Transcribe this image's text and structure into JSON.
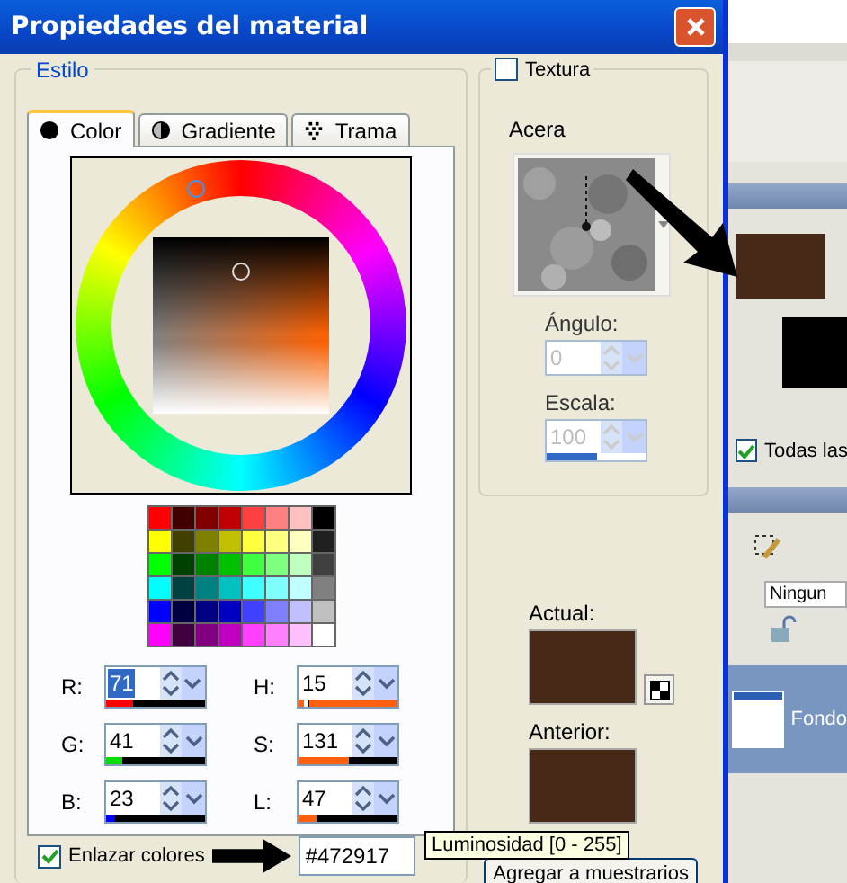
{
  "window": {
    "title": "Propiedades del material"
  },
  "style_group": {
    "title": "Estilo"
  },
  "tabs": [
    {
      "label": "Color",
      "selected": true,
      "kind": "solid"
    },
    {
      "label": "Gradiente",
      "selected": false,
      "kind": "gradient"
    },
    {
      "label": "Trama",
      "selected": false,
      "kind": "pattern"
    }
  ],
  "palette": [
    {
      "color": "#ff0000"
    },
    {
      "color": "#400000"
    },
    {
      "color": "#800000"
    },
    {
      "color": "#c00000"
    },
    {
      "color": "#ff4040"
    },
    {
      "color": "#ff8080"
    },
    {
      "color": "#ffc0c0"
    },
    {
      "color": "#000000"
    },
    {
      "color": "#ffff00"
    },
    {
      "color": "#404000"
    },
    {
      "color": "#808000"
    },
    {
      "color": "#c0c000"
    },
    {
      "color": "#ffff40"
    },
    {
      "color": "#ffff80"
    },
    {
      "color": "#ffffc0"
    },
    {
      "color": "#202020"
    },
    {
      "color": "#00ff00"
    },
    {
      "color": "#004000"
    },
    {
      "color": "#008000"
    },
    {
      "color": "#00c000"
    },
    {
      "color": "#40ff40"
    },
    {
      "color": "#80ff80"
    },
    {
      "color": "#c0ffc0"
    },
    {
      "color": "#404040"
    },
    {
      "color": "#00ffff"
    },
    {
      "color": "#004040"
    },
    {
      "color": "#008080"
    },
    {
      "color": "#00c0c0"
    },
    {
      "color": "#40ffff"
    },
    {
      "color": "#80ffff"
    },
    {
      "color": "#c0ffff"
    },
    {
      "color": "#808080"
    },
    {
      "color": "#0000ff"
    },
    {
      "color": "#000040"
    },
    {
      "color": "#000080"
    },
    {
      "color": "#0000c0"
    },
    {
      "color": "#4040ff"
    },
    {
      "color": "#8080ff"
    },
    {
      "color": "#c0c0ff"
    },
    {
      "color": "#c0c0c0"
    },
    {
      "color": "#ff00ff"
    },
    {
      "color": "#400040"
    },
    {
      "color": "#800080"
    },
    {
      "color": "#c000c0"
    },
    {
      "color": "#ff40ff"
    },
    {
      "color": "#ff80ff"
    },
    {
      "color": "#ffc0ff"
    },
    {
      "color": "#ffffff"
    }
  ],
  "fields": [
    {
      "label": "R:",
      "value": "71",
      "selected": true,
      "level": 0.28,
      "color": "#ff0000"
    },
    {
      "label": "H:",
      "value": "15",
      "selected": false,
      "level": 0.06,
      "color": "#ff6010"
    },
    {
      "label": "G:",
      "value": "41",
      "selected": false,
      "level": 0.16,
      "color": "#00dd00"
    },
    {
      "label": "S:",
      "value": "131",
      "selected": false,
      "level": 0.51,
      "color": "#ff6010"
    },
    {
      "label": "B:",
      "value": "23",
      "selected": false,
      "level": 0.09,
      "color": "#0000ff"
    },
    {
      "label": "L:",
      "value": "47",
      "selected": false,
      "level": 0.18,
      "color": "#ff6010"
    }
  ],
  "link_colors": {
    "label": "Enlazar colores",
    "checked": true
  },
  "hex_field": {
    "value": "#472917"
  },
  "tooltip": "Luminosidad [0 - 255]",
  "texture": {
    "label": "Textura",
    "checked": false,
    "name": "Acera",
    "angle": {
      "label": "Ángulo:",
      "value": "0",
      "disabled": true
    },
    "scale": {
      "label": "Escala:",
      "value": "100",
      "disabled": true,
      "level": 0.5
    }
  },
  "current": {
    "label": "Actual:",
    "color": "#472917"
  },
  "previous": {
    "label": "Anterior:",
    "color": "#472917"
  },
  "add_button": "Agregar a muestrarios",
  "background_app": {
    "foreground": {
      "color": "#472917"
    },
    "all_tools": {
      "label": "Todas las",
      "checked": true
    },
    "blend_field": "Ningun",
    "layer": "Fondo"
  }
}
